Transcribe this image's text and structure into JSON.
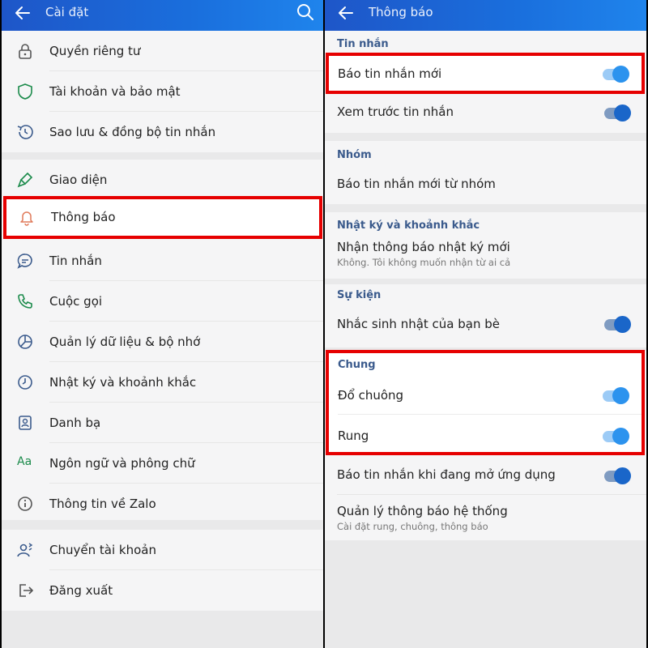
{
  "left": {
    "title": "Cài đặt",
    "items": [
      {
        "label": "Quyền riêng tư",
        "icon": "lock-icon"
      },
      {
        "label": "Tài khoản và bảo mật",
        "icon": "shield-icon"
      },
      {
        "label": "Sao lưu & đồng bộ tin nhắn",
        "icon": "history-icon"
      },
      {
        "label": "Giao diện",
        "icon": "paintbrush-icon"
      },
      {
        "label": "Thông báo",
        "icon": "bell-icon"
      },
      {
        "label": "Tin nhắn",
        "icon": "chat-icon"
      },
      {
        "label": "Cuộc gọi",
        "icon": "phone-icon"
      },
      {
        "label": "Quản lý dữ liệu & bộ nhớ",
        "icon": "pie-chart-icon"
      },
      {
        "label": "Nhật ký và khoảnh khắc",
        "icon": "clock-icon"
      },
      {
        "label": "Danh bạ",
        "icon": "contacts-icon"
      },
      {
        "label": "Ngôn ngữ và phông chữ",
        "icon": "font-icon",
        "glyph": "Aa"
      },
      {
        "label": "Thông tin về Zalo",
        "icon": "info-icon"
      },
      {
        "label": "Chuyển tài khoản",
        "icon": "switch-account-icon"
      },
      {
        "label": "Đăng xuất",
        "icon": "logout-icon"
      }
    ]
  },
  "right": {
    "title": "Thông báo",
    "sections": {
      "messages": {
        "header": "Tin nhắn",
        "new_message": {
          "label": "Báo tin nhắn mới",
          "on": true
        },
        "preview": {
          "label": "Xem trước tin nhắn",
          "on": true
        }
      },
      "groups": {
        "header": "Nhóm",
        "group_new": {
          "label": "Báo tin nhắn mới từ nhóm"
        }
      },
      "diary": {
        "header": "Nhật ký và khoảnh khắc",
        "diary_new": {
          "label": "Nhận thông báo nhật ký mới",
          "sub": "Không. Tôi không muốn nhận từ ai cả"
        }
      },
      "events": {
        "header": "Sự kiện",
        "birthday": {
          "label": "Nhắc sinh nhật của bạn bè",
          "on": true
        }
      },
      "general": {
        "header": "Chung",
        "ring": {
          "label": "Đổ chuông",
          "on": true
        },
        "vibrate": {
          "label": "Rung",
          "on": true
        },
        "in_app": {
          "label": "Báo tin nhắn khi đang mở ứng dụng",
          "on": true
        },
        "system": {
          "label": "Quản lý thông báo hệ thống",
          "sub": "Cài đặt rung, chuông, thông báo"
        }
      }
    }
  },
  "colors": {
    "highlight": "#e60000",
    "appbar": "#1a6fdd",
    "toggle_on": "#2c93ee"
  }
}
